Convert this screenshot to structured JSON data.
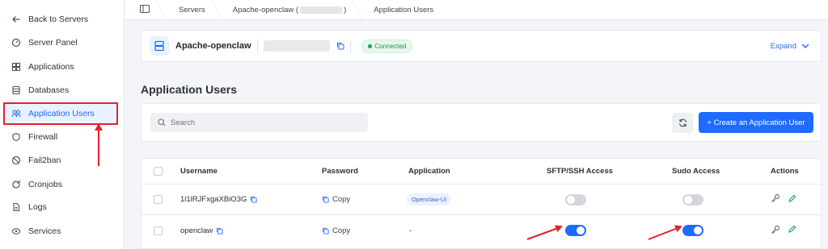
{
  "sidebar": {
    "items": [
      {
        "label": "Back to Servers",
        "icon": "arrow-left-icon"
      },
      {
        "label": "Server Panel",
        "icon": "gauge-icon"
      },
      {
        "label": "Applications",
        "icon": "apps-icon"
      },
      {
        "label": "Databases",
        "icon": "database-icon"
      },
      {
        "label": "Application Users",
        "icon": "users-icon",
        "active": true
      },
      {
        "label": "Firewall",
        "icon": "shield-icon"
      },
      {
        "label": "Fail2ban",
        "icon": "ban-icon"
      },
      {
        "label": "Cronjobs",
        "icon": "refresh-icon"
      },
      {
        "label": "Logs",
        "icon": "file-icon"
      },
      {
        "label": "Services",
        "icon": "services-icon"
      }
    ]
  },
  "breadcrumb": {
    "servers": "Servers",
    "server_prefix": "Apache-openclaw (",
    "server_suffix": ")",
    "current": "Application Users"
  },
  "server": {
    "name": "Apache-openclaw",
    "status": "Connected",
    "expand_label": "Expand"
  },
  "page": {
    "title": "Application Users"
  },
  "search": {
    "placeholder": "Search"
  },
  "create_button": "+ Create an Application User",
  "table": {
    "headers": {
      "username": "Username",
      "password": "Password",
      "application": "Application",
      "sftp": "SFTP/SSH Access",
      "sudo": "Sudo Access",
      "actions": "Actions"
    },
    "rows": [
      {
        "username": "1l1lRJFxgaXBiO3G",
        "password": "Copy",
        "application": "Openclaw-UI",
        "sftp": false,
        "sudo": false
      },
      {
        "username": "openclaw",
        "password": "Copy",
        "application": "-",
        "sftp": true,
        "sudo": true
      }
    ]
  },
  "colors": {
    "accent": "#1f6bff",
    "highlight_border": "#e5202b",
    "status_green": "#17954a"
  }
}
